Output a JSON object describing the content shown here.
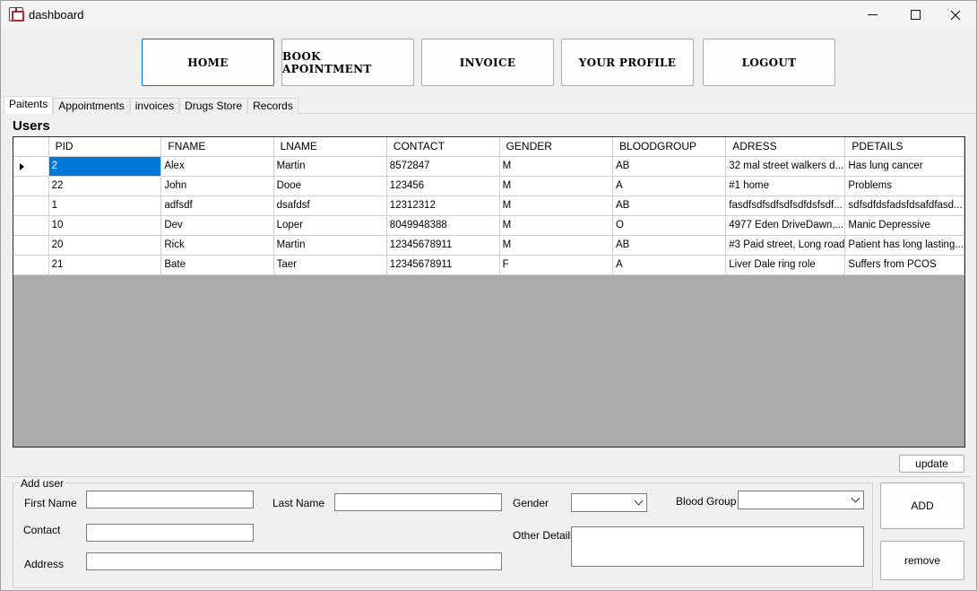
{
  "window": {
    "title": "dashboard"
  },
  "nav": {
    "home": "HOME",
    "book": "BOOK APOINTMENT",
    "invoice": "INVOICE",
    "profile": "YOUR PROFILE",
    "logout": "LOGOUT"
  },
  "tabs": [
    "Paitents",
    "Appointments",
    "invoices",
    "Drugs Store",
    "Records"
  ],
  "section_title": "Users",
  "table": {
    "columns": [
      "PID",
      "FNAME",
      "LNAME",
      "CONTACT",
      "GENDER",
      "BLOODGROUP",
      "ADRESS",
      "PDETAILS"
    ],
    "rows": [
      [
        "2",
        "Alex",
        "Martin",
        "8572847",
        "M",
        "AB",
        "32 mal street walkers d...",
        "Has  lung cancer"
      ],
      [
        "22",
        "John",
        "Dooe",
        "123456",
        "M",
        "A",
        "#1 home",
        "Problems"
      ],
      [
        "1",
        "adfsdf",
        "dsafdsf",
        "12312312",
        "M",
        "AB",
        "fasdfsdfsdfsdfsdfdsfsdf...",
        "sdfsdfdsfadsfdsafdfasd..."
      ],
      [
        "10",
        "Dev",
        "Loper",
        "8049948388",
        "M",
        "O",
        "4977 Eden DriveDawn,...",
        "Manic Depressive"
      ],
      [
        "20",
        "Rick",
        "Martin",
        "12345678911",
        "M",
        "AB",
        "#3 Paid street, Long road",
        "Patient has long lasting..."
      ],
      [
        "21",
        "Bate",
        "Taer",
        "12345678911",
        "F",
        "A",
        "Liver Dale ring role",
        "Suffers from PCOS"
      ]
    ],
    "selected_row": 0
  },
  "buttons": {
    "update": "update",
    "add": "ADD",
    "remove": "remove"
  },
  "form": {
    "group_title": "Add user",
    "first_name_label": "First Name",
    "last_name_label": "Last Name",
    "gender_label": "Gender",
    "blood_group_label": "Blood Group",
    "contact_label": "Contact",
    "other_details_label": "Other Details",
    "address_label": "Address",
    "first_name_value": "",
    "last_name_value": "",
    "contact_value": "",
    "address_value": "",
    "other_details_value": "",
    "gender_value": "",
    "blood_group_value": ""
  },
  "colors": {
    "selection": "#0078d7",
    "grid_background": "#ababab",
    "window": "#f0f0f0"
  }
}
